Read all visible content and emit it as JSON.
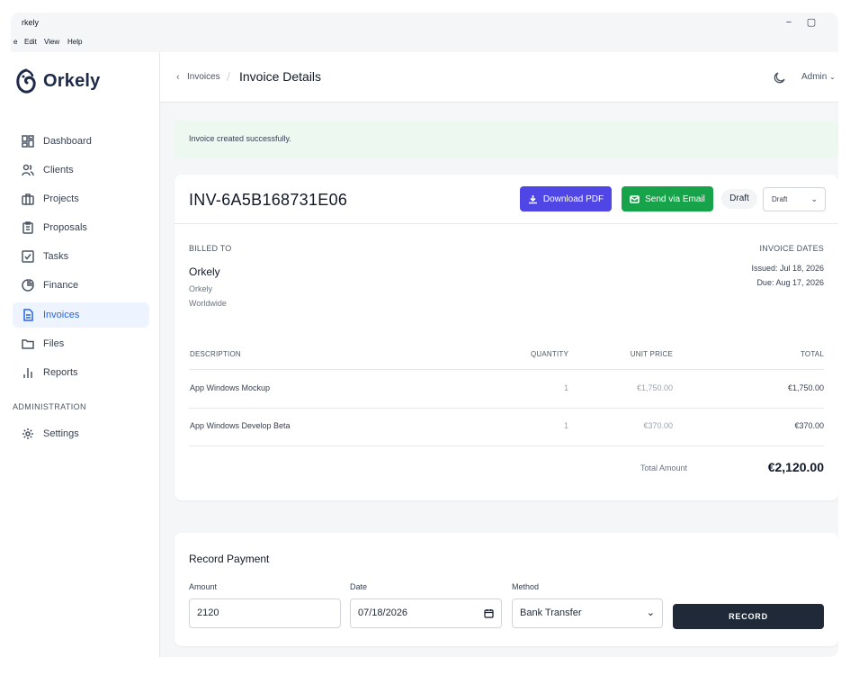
{
  "window": {
    "title": "rkely",
    "minimize": "−",
    "maximize": "▢"
  },
  "menu": [
    "e",
    "Edit",
    "View",
    "Help"
  ],
  "brand": {
    "name": "Orkely",
    "color": "#1e2a4a"
  },
  "sidebar": {
    "items": [
      {
        "label": "Dashboard",
        "icon": "dashboard-icon"
      },
      {
        "label": "Clients",
        "icon": "users-icon"
      },
      {
        "label": "Projects",
        "icon": "briefcase-icon"
      },
      {
        "label": "Proposals",
        "icon": "clipboard-icon"
      },
      {
        "label": "Tasks",
        "icon": "checkbox-icon"
      },
      {
        "label": "Finance",
        "icon": "pie-chart-icon"
      },
      {
        "label": "Invoices",
        "icon": "file-text-icon",
        "active": true
      },
      {
        "label": "Files",
        "icon": "folder-icon"
      },
      {
        "label": "Reports",
        "icon": "bar-chart-icon"
      }
    ],
    "section_admin": "ADMINISTRATION",
    "settings": {
      "label": "Settings",
      "icon": "gear-icon"
    }
  },
  "header": {
    "breadcrumb_link": "Invoices",
    "separator": "/",
    "title": "Invoice Details",
    "user": "Admin"
  },
  "alert": {
    "message": "Invoice created successfully."
  },
  "invoice": {
    "number": "INV-6A5B168731E06",
    "download_label": "Download PDF",
    "email_label": "Send via Email",
    "status_badge": "Draft",
    "status_select": "Draft",
    "billed_to_label": "BILLED TO",
    "client_name": "Orkely",
    "client_line1": "Orkely",
    "client_line2": "Worldwide",
    "dates_label": "INVOICE DATES",
    "issued": "Issued: Jul 18, 2026",
    "due": "Due: Aug 17, 2026",
    "columns": {
      "description": "DESCRIPTION",
      "quantity": "QUANTITY",
      "unit_price": "UNIT PRICE",
      "total": "TOTAL"
    },
    "items": [
      {
        "description": "App Windows Mockup",
        "quantity": "1",
        "unit_price": "€1,750.00",
        "total": "€1,750.00"
      },
      {
        "description": "App Windows Develop Beta",
        "quantity": "1",
        "unit_price": "€370.00",
        "total": "€370.00"
      }
    ],
    "total_label": "Total Amount",
    "total_value": "€2,120.00"
  },
  "payment": {
    "title": "Record Payment",
    "amount_label": "Amount",
    "amount_value": "2120",
    "date_label": "Date",
    "date_value": "07/18/2026",
    "method_label": "Method",
    "method_value": "Bank Transfer",
    "record_label": "RECORD"
  },
  "colors": {
    "primary_button": "#4f46e5",
    "success_button": "#16a34a",
    "active_nav": "#2563eb",
    "alert_bg": "#edf8f1",
    "dark_button": "#1f2937"
  }
}
